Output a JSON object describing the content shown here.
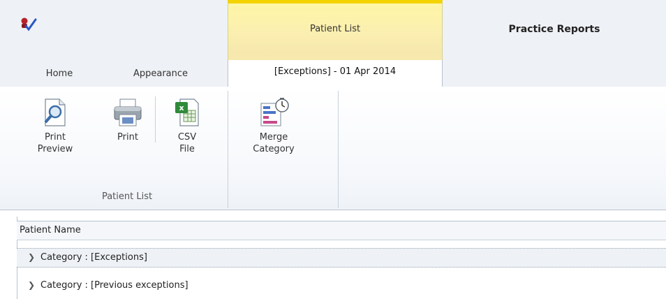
{
  "window": {
    "title": "Practice Reports",
    "contextual_tab_label": "Patient List"
  },
  "tabs": [
    {
      "label": "Home"
    },
    {
      "label": "Appearance"
    },
    {
      "label": "[Exceptions] - 01 Apr 2014",
      "active": true
    }
  ],
  "ribbon": {
    "buttons": [
      {
        "line1": "Print",
        "line2": "Preview",
        "icon": "print-preview-icon"
      },
      {
        "line1": "Print",
        "line2": "",
        "icon": "printer-icon"
      },
      {
        "line1": "CSV",
        "line2": "File",
        "icon": "excel-csv-icon"
      },
      {
        "line1": "Merge",
        "line2": "Category",
        "icon": "merge-category-icon"
      }
    ],
    "group_label": "Patient List"
  },
  "grid": {
    "column_header": "Patient Name",
    "rows": [
      {
        "label": "Category : [Exceptions]"
      },
      {
        "label": "Category : [Previous exceptions]"
      }
    ]
  },
  "colors": {
    "contextual_tab": "#fbefb0",
    "contextual_tab_accent": "#f4d400",
    "chrome": "#eef1f5",
    "border": "#b8c2cf"
  }
}
